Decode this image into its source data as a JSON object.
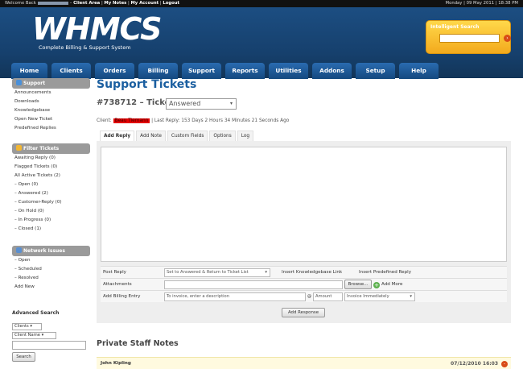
{
  "topbar": {
    "welcome": "Welcome Back",
    "links": [
      "Client Area",
      "My Notes",
      "My Account",
      "Logout"
    ],
    "datetime": "Monday | 09 May 2011 | 18:38 PM"
  },
  "brand": {
    "logo": "WHMCS",
    "tagline": "Complete Billing & Support System"
  },
  "search": {
    "title": "Intelligent Search",
    "go_icon": "arrow-right-icon"
  },
  "nav": [
    "Home",
    "Clients",
    "Orders",
    "Billing",
    "Support",
    "Reports",
    "Utilities",
    "Addons",
    "Setup",
    "Help"
  ],
  "sidebar": {
    "support": {
      "title": "Support",
      "items": [
        "Announcements",
        "Downloads",
        "Knowledgebase",
        "Open New Ticket",
        "Predefined Replies"
      ]
    },
    "filter": {
      "title": "Filter Tickets",
      "items": [
        "Awaiting Reply (0)",
        "Flagged Tickets (0)",
        "All Active Tickets (2)",
        "– Open (0)",
        "– Answered (2)",
        "– Customer-Reply (0)",
        "– On Hold (0)",
        "– In Progress (0)",
        "– Closed (1)"
      ]
    },
    "network": {
      "title": "Network Issues",
      "items": [
        "– Open",
        "– Scheduled",
        "– Resolved",
        "Add New"
      ]
    },
    "advanced": {
      "title": "Advanced Search",
      "select1": "Clients",
      "select2": "Client Name",
      "button": "Search"
    }
  },
  "main": {
    "page_title": "Support Tickets",
    "ticket_label": "#738712 – Ticket",
    "status": "Answered",
    "client_label": "Client:",
    "client_name": "Beau Tiemann",
    "last_reply": "| Last Reply: 153 Days 2 Hours 34 Minutes 21 Seconds Ago",
    "tabs": [
      "Add Reply",
      "Add Note",
      "Custom Fields",
      "Options",
      "Log"
    ],
    "form": {
      "post_reply_label": "Post Reply",
      "post_reply_value": "Set to Answered & Return to Ticket List",
      "insert_kb": "Insert Knowledgebase Link",
      "insert_predef": "Insert Predefined Reply",
      "attachments_label": "Attachments",
      "browse": "Browse...",
      "add_more": "Add More",
      "billing_label": "Add Billing Entry",
      "billing_placeholder": "To invoice, enter a description",
      "amount_placeholder": "Amount",
      "invoice_option": "Invoice Immediately",
      "submit": "Add Response"
    },
    "notes": {
      "title": "Private Staff Notes",
      "author": "John Kipling",
      "date": "07/12/2010 16:03"
    }
  }
}
